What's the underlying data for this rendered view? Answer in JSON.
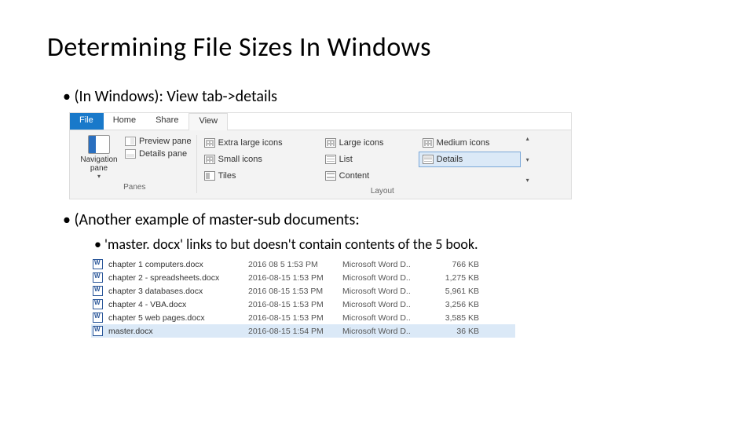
{
  "title": "Determining File Sizes In Windows",
  "bullets": {
    "b1": "(In Windows): View tab->details",
    "b2": "(Another example of master-sub documents:",
    "b2a": "'master. docx' links to but doesn't contain contents of the 5 book."
  },
  "ribbon": {
    "tabs": {
      "file": "File",
      "home": "Home",
      "share": "Share",
      "view": "View"
    },
    "navpane": "Navigation pane",
    "preview_pane": "Preview pane",
    "details_pane": "Details pane",
    "panes_caption": "Panes",
    "layout": {
      "xl": "Extra large icons",
      "large": "Large icons",
      "medium": "Medium icons",
      "small": "Small icons",
      "list": "List",
      "details": "Details",
      "tiles": "Tiles",
      "content": "Content"
    },
    "layout_caption": "Layout"
  },
  "files": [
    {
      "name": "chapter 1   computers.docx",
      "date": "2016 08  5 1:53 PM",
      "type": "Microsoft Word D..",
      "size": "766 KB"
    },
    {
      "name": "chapter 2 - spreadsheets.docx",
      "date": "2016-08-15 1:53 PM",
      "type": "Microsoft Word D..",
      "size": "1,275 KB"
    },
    {
      "name": "chapter 3   databases.docx",
      "date": "2016 08-15 1:53 PM",
      "type": "Microsoft Word D..",
      "size": "5,961 KB"
    },
    {
      "name": "chapter 4 - VBA.docx",
      "date": "2016-08-15 1:53 PM",
      "type": "Microsoft Word D..",
      "size": "3,256 KB"
    },
    {
      "name": "chapter 5   web pages.docx",
      "date": "2016-08-15 1:53 PM",
      "type": "Microsoft Word D..",
      "size": "3,585 KB"
    },
    {
      "name": "master.docx",
      "date": "2016-08-15 1:54 PM",
      "type": "Microsoft Word D..",
      "size": "36 KB"
    }
  ]
}
